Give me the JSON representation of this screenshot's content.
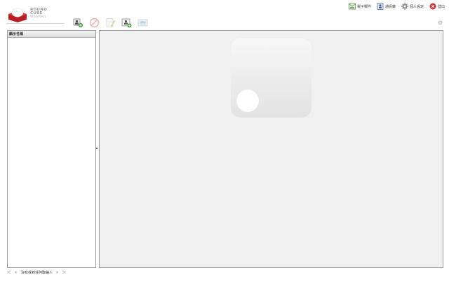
{
  "app": {
    "logo_line1": "ROUND",
    "logo_line2": "CUBE",
    "logo_line3": "WEBMAIL"
  },
  "topnav": {
    "items": [
      {
        "label": "電子郵件",
        "icon": "mail-icon"
      },
      {
        "label": "通訊錄",
        "icon": "address-book-icon"
      },
      {
        "label": "個人設定",
        "icon": "settings-icon"
      },
      {
        "label": "登出",
        "icon": "logout-icon"
      }
    ]
  },
  "toolbar": {
    "buttons": [
      {
        "icon": "add-contact-icon"
      },
      {
        "icon": "delete-icon"
      },
      {
        "icon": "compose-icon"
      },
      {
        "icon": "import-icon"
      },
      {
        "icon": "export-icon"
      }
    ]
  },
  "search": {
    "value": "",
    "placeholder": ""
  },
  "contact_list": {
    "header": "顯示名稱"
  },
  "footer": {
    "count_text": "沒有找到任何聯絡人"
  },
  "colors": {
    "logo_red": "#cc2228",
    "panel_border": "#999999",
    "content_bg": "#f0f0f0"
  }
}
